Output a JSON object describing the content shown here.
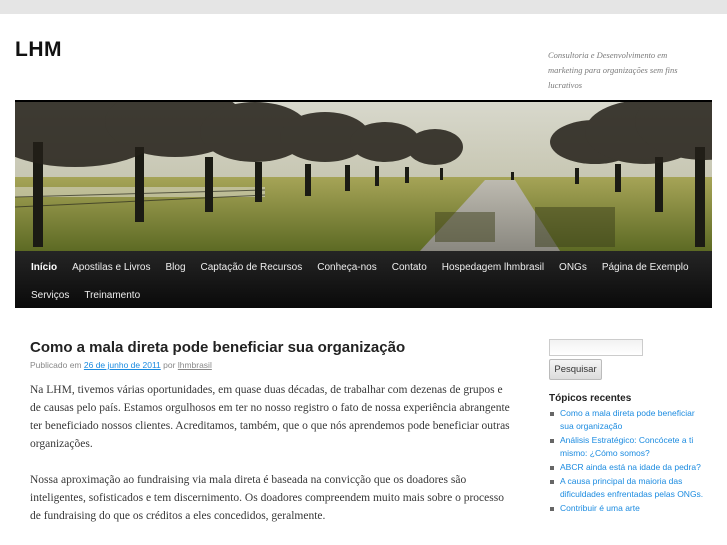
{
  "site": {
    "title": "LHM",
    "description": "Consultoria e Desenvolvimento em marketing para organizações sem fins lucrativos"
  },
  "nav": {
    "row1": [
      "Início",
      "Apostilas e Livros",
      "Blog",
      "Captação de Recursos",
      "Conheça-nos",
      "Contato",
      "Hospedagem lhmbrasil",
      "ONGs",
      "Página de Exemplo"
    ],
    "row2": [
      "Serviços",
      "Treinamento"
    ]
  },
  "post": {
    "title": "Como a mala direta pode beneficiar sua organização",
    "meta_prefix": "Publicado em",
    "date": "26 de junho de 2011",
    "meta_by": "por",
    "author": "lhmbrasil",
    "paragraphs": [
      "Na LHM, tivemos várias oportunidades, em quase duas décadas, de trabalhar com dezenas de grupos e de causas pelo país. Estamos orgulhosos em ter no nosso registro o fato de nossa experiência abrangente ter beneficiado nossos clientes. Acreditamos, também, que o que nós aprendemos pode beneficiar outras organizações.",
      "Nossa aproximação ao fundraising via mala direta é baseada na convicção que os doadores são inteligentes, sofisticados e tem discernimento. Os doadores compreendem muito mais sobre o processo de fundraising do que os créditos a eles concedidos, geralmente."
    ]
  },
  "sidebar": {
    "search_placeholder": "",
    "search_button": "Pesquisar",
    "recent_title": "Tópicos recentes",
    "recent_posts": [
      "Como a mala direta pode beneficiar sua organização",
      "Análisis Estratégico: Concócete a ti mismo: ¿Cómo somos?",
      "ABCR ainda está na idade da pedra?",
      "A causa principal da maioria das dificuldades enfrentadas pelas ONGs.",
      "Contribuir é uma arte"
    ]
  },
  "colors": {
    "link": "#1b8be0",
    "nav_bg": "#111111",
    "page_bg": "#e5e5e5"
  }
}
